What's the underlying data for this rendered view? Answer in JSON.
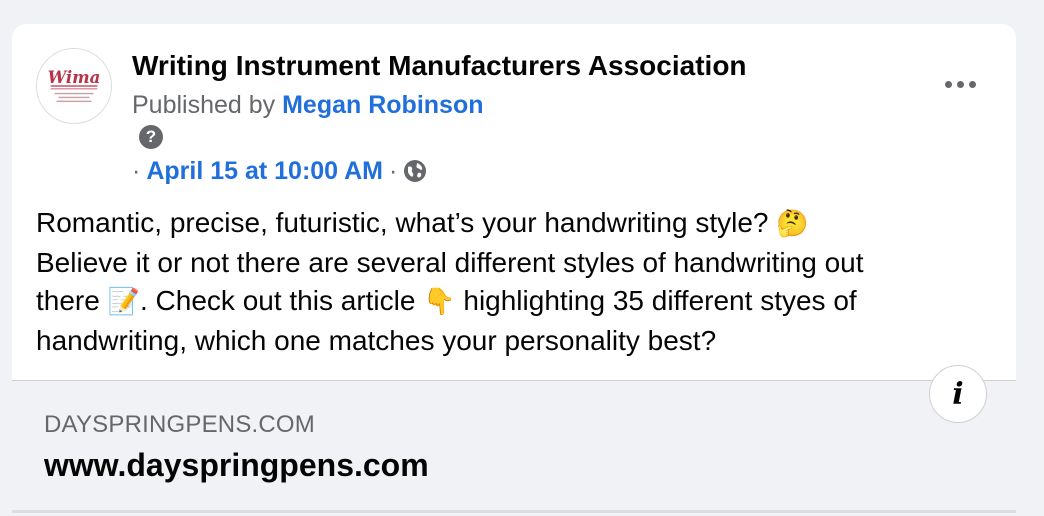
{
  "post": {
    "page_name": "Writing Instrument Manufacturers Association",
    "avatar_text": "Wima",
    "published_by_label": "Published by ",
    "author": "Megan Robinson",
    "help_icon": "?",
    "dot": "·",
    "timestamp": "April 15 at 10:00 AM",
    "privacy_icon": "globe-icon",
    "more_icon": "more-horizontal-icon",
    "text": {
      "line1": "Romantic, precise, futuristic, what’s your handwriting style? ",
      "emoji1": "🤔",
      "line2": "Believe it or not there are several different styles of handwriting out",
      "line3a": "there ",
      "emoji2": "📝",
      "line3b": ". Check out this article ",
      "emoji3": "👇",
      "line3c": " highlighting 35 different styes of",
      "line4": "handwriting, which one matches your personality best?"
    }
  },
  "link_preview": {
    "domain": "DAYSPRINGPENS.COM",
    "title": "www.dayspringpens.com",
    "info_icon": "i"
  },
  "colors": {
    "background": "#f0f2f5",
    "link_blue": "#216fdb",
    "secondary_text": "#65676b",
    "logo_red": "#b8334a"
  }
}
